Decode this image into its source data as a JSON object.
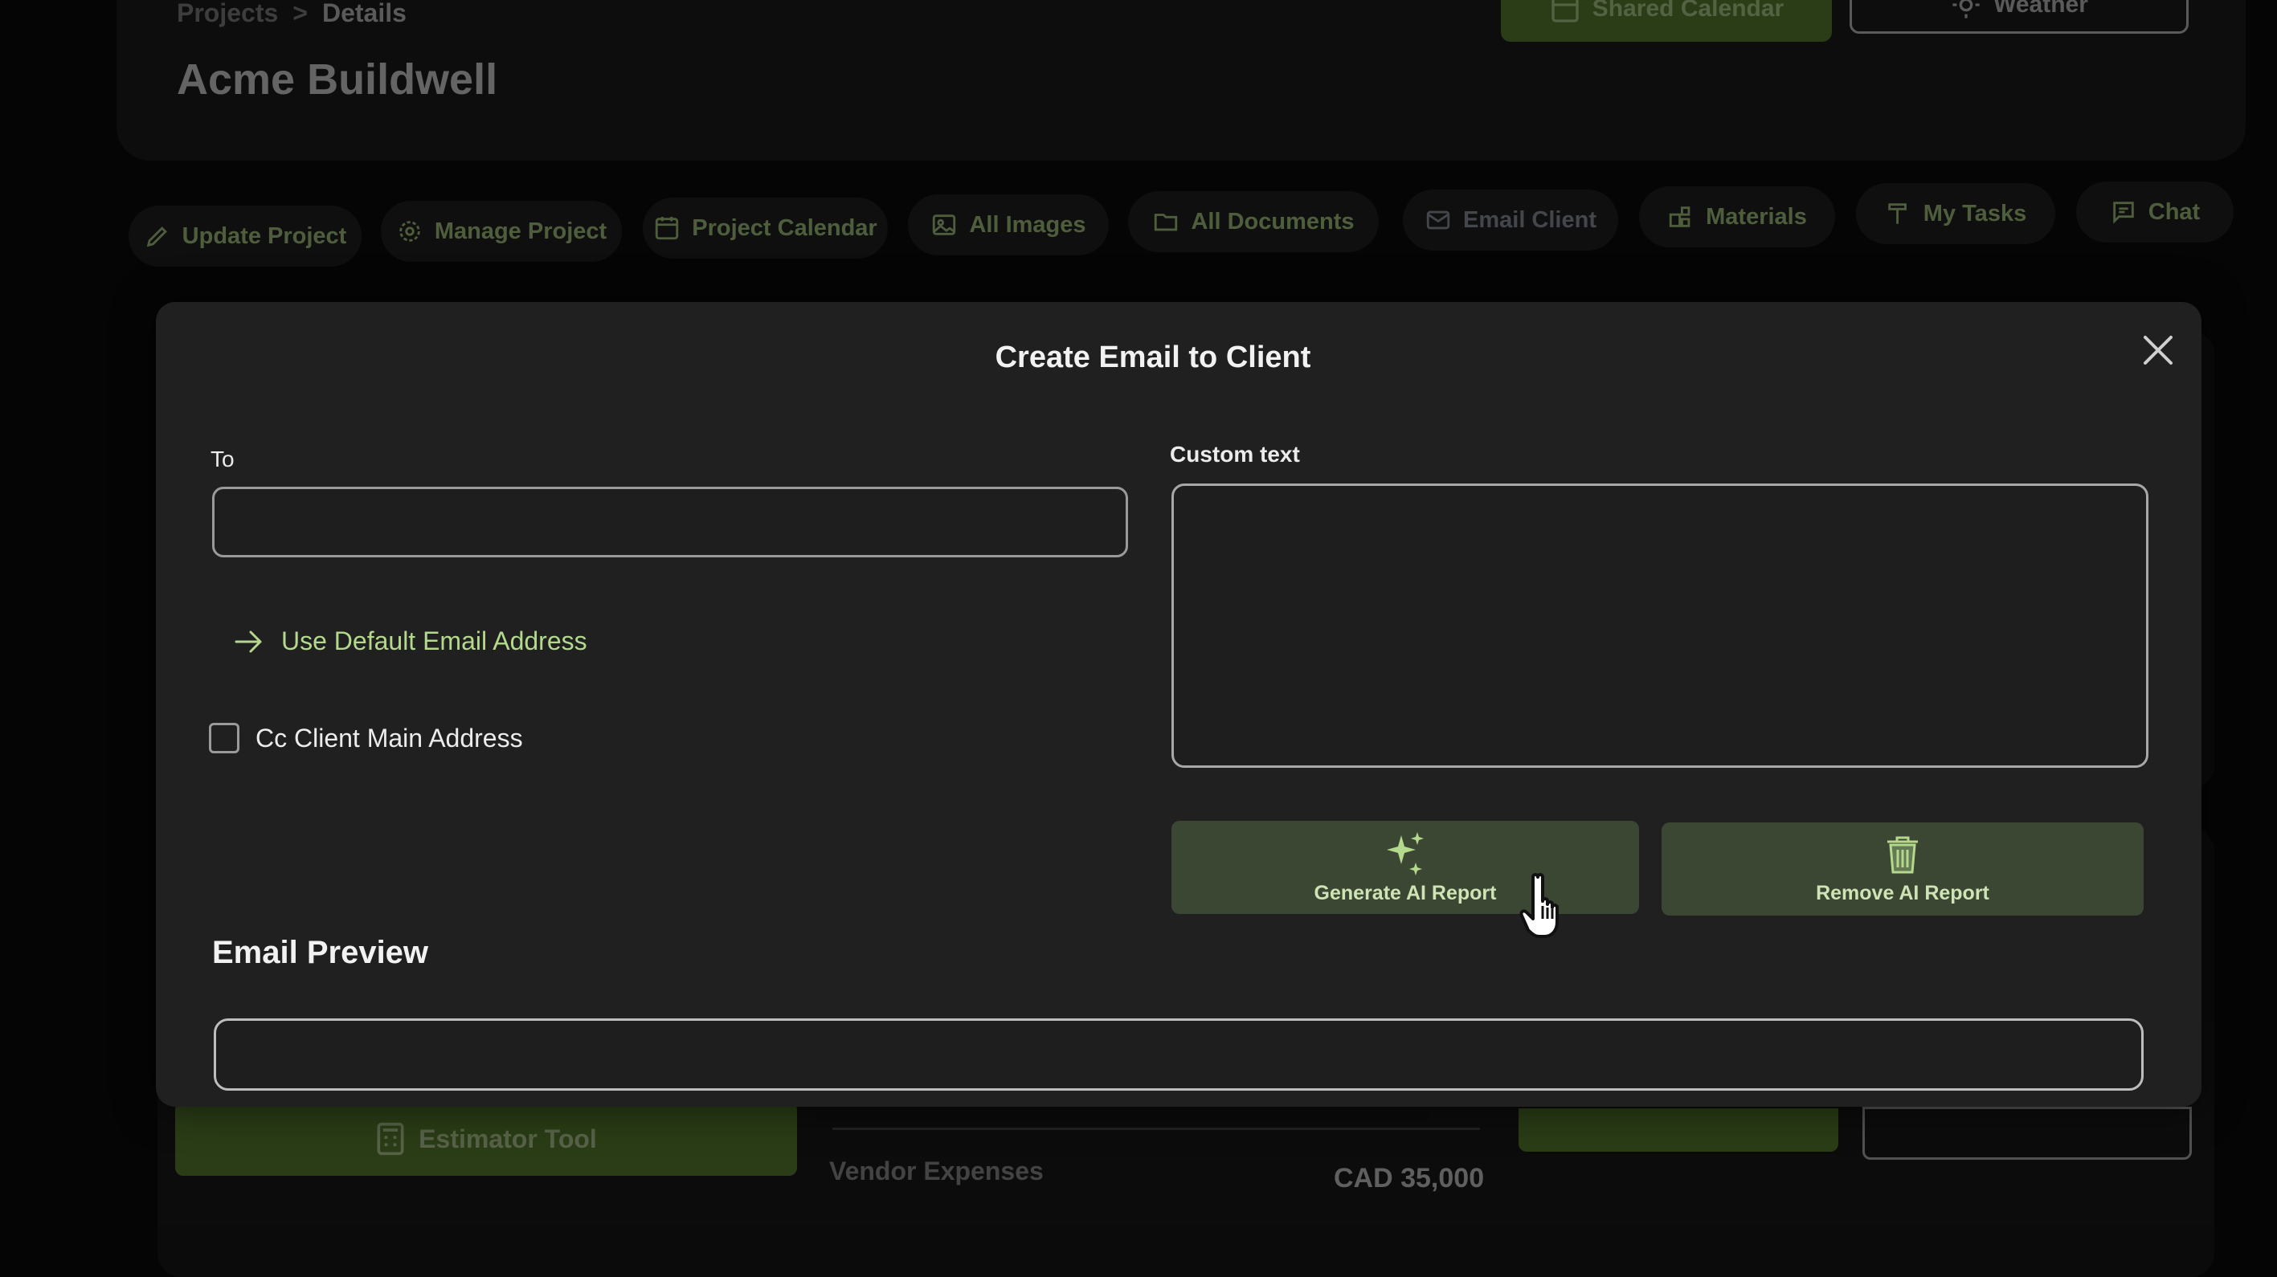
{
  "breadcrumb": {
    "parent": "Projects",
    "separator": ">",
    "current": "Details"
  },
  "page_title": "Acme Buildwell",
  "header_buttons": {
    "shared_calendar": "Shared Calendar",
    "weather": "Weather"
  },
  "tabs": [
    {
      "label": "Update Project",
      "icon": "pencil-icon"
    },
    {
      "label": "Manage Project",
      "icon": "gear-icon"
    },
    {
      "label": "Project Calendar",
      "icon": "calendar-icon"
    },
    {
      "label": "All Images",
      "icon": "image-icon"
    },
    {
      "label": "All Documents",
      "icon": "folder-icon"
    },
    {
      "label": "Email Client",
      "icon": "mail-icon"
    },
    {
      "label": "Materials",
      "icon": "materials-icon"
    },
    {
      "label": "My Tasks",
      "icon": "hammer-icon"
    },
    {
      "label": "Chat",
      "icon": "chat-icon"
    }
  ],
  "background": {
    "estimator_button": "Estimator Tool",
    "vendor_expenses_label": "Vendor Expenses",
    "vendor_expenses_amount": "CAD 35,000"
  },
  "modal": {
    "title": "Create Email to Client",
    "to_label": "To",
    "to_value": "",
    "use_default_link": "Use Default Email Address",
    "cc_label": "Cc Client Main Address",
    "cc_checked": false,
    "custom_text_label": "Custom text",
    "custom_text_value": "",
    "generate_button": "Generate AI Report",
    "remove_button": "Remove AI Report",
    "preview_heading": "Email Preview"
  },
  "colors": {
    "accent": "#b4d98c",
    "accent_green": "#5f8c2e",
    "modal_bg": "#202020",
    "button_bg": "#3b4633"
  }
}
